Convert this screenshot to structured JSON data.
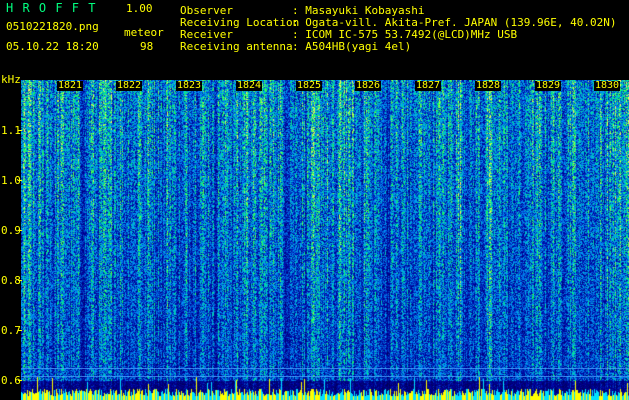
{
  "header": {
    "app_name": "H R O F F T",
    "version": "1.00",
    "filename": "0510221820.png",
    "meteor_label": "meteor",
    "meteor_count": "98",
    "datetime": "05.10.22 18:20",
    "info": [
      {
        "key": "Observer",
        "value": ": Masayuki Kobayashi"
      },
      {
        "key": "Receiving Location",
        "value": ": Ogata-vill. Akita-Pref. JAPAN (139.96E, 40.02N)"
      },
      {
        "key": "Receiver",
        "value": ": ICOM IC-575 53.7492(@LCD)MHz USB"
      },
      {
        "key": "Receiving antenna",
        "value": ": A504HB(yagi 4el)"
      }
    ]
  },
  "axis": {
    "unit": "kHz",
    "y_ticks": [
      "1.1",
      "1.0",
      "0.9",
      "0.8",
      "0.7",
      "0.6"
    ],
    "time_ticks": [
      "1821",
      "1822",
      "1823",
      "1824",
      "1825",
      "1826",
      "1827",
      "1828",
      "1829",
      "1830"
    ]
  },
  "colors": {
    "text": "#ffff00",
    "title": "#00ff7f",
    "background": "#000000"
  }
}
